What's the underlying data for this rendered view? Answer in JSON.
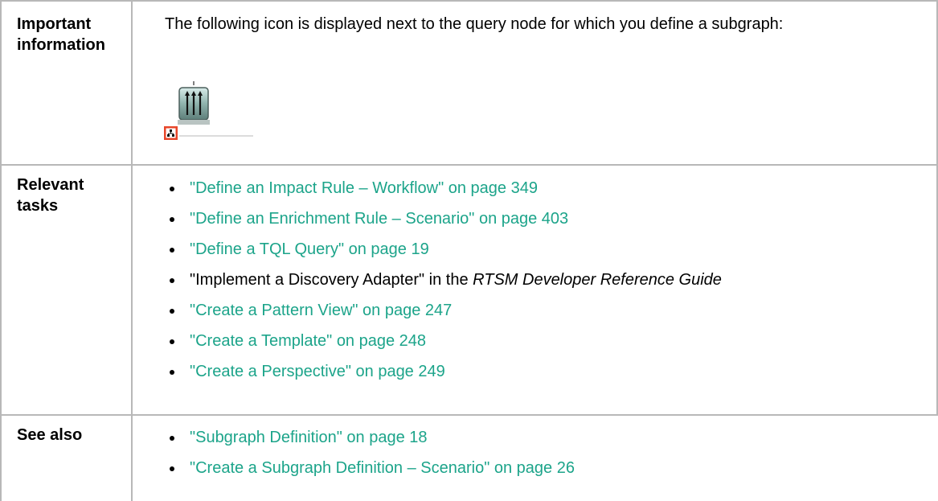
{
  "rows": [
    {
      "label": "Important information",
      "text": "The following icon is displayed next to the query node for which you define a subgraph:",
      "icon": "query-node-with-subgraph-icon"
    },
    {
      "label": "Relevant tasks",
      "items": [
        {
          "kind": "link",
          "text": "\"Define an Impact Rule – Workflow\" on page 349"
        },
        {
          "kind": "link",
          "text": "\"Define an Enrichment Rule – Scenario\" on page 403"
        },
        {
          "kind": "link",
          "text": "\"Define a TQL Query\" on page 19"
        },
        {
          "kind": "text",
          "prefix": "\"Implement a Discovery Adapter\" in the ",
          "emph": "RTSM Developer Reference Guide"
        },
        {
          "kind": "link",
          "text": "\"Create a Pattern View\" on page 247"
        },
        {
          "kind": "link",
          "text": "\"Create a Template\" on page 248"
        },
        {
          "kind": "link",
          "text": "\"Create a Perspective\" on page 249"
        }
      ]
    },
    {
      "label": "See also",
      "items": [
        {
          "kind": "link",
          "text": "\"Subgraph Definition\" on page 18"
        },
        {
          "kind": "link",
          "text": "\"Create a Subgraph Definition – Scenario\" on page 26"
        }
      ]
    }
  ],
  "colors": {
    "link": "#1ca48a",
    "border": "#b8b8b8",
    "icon_accent": "#e8462a"
  }
}
